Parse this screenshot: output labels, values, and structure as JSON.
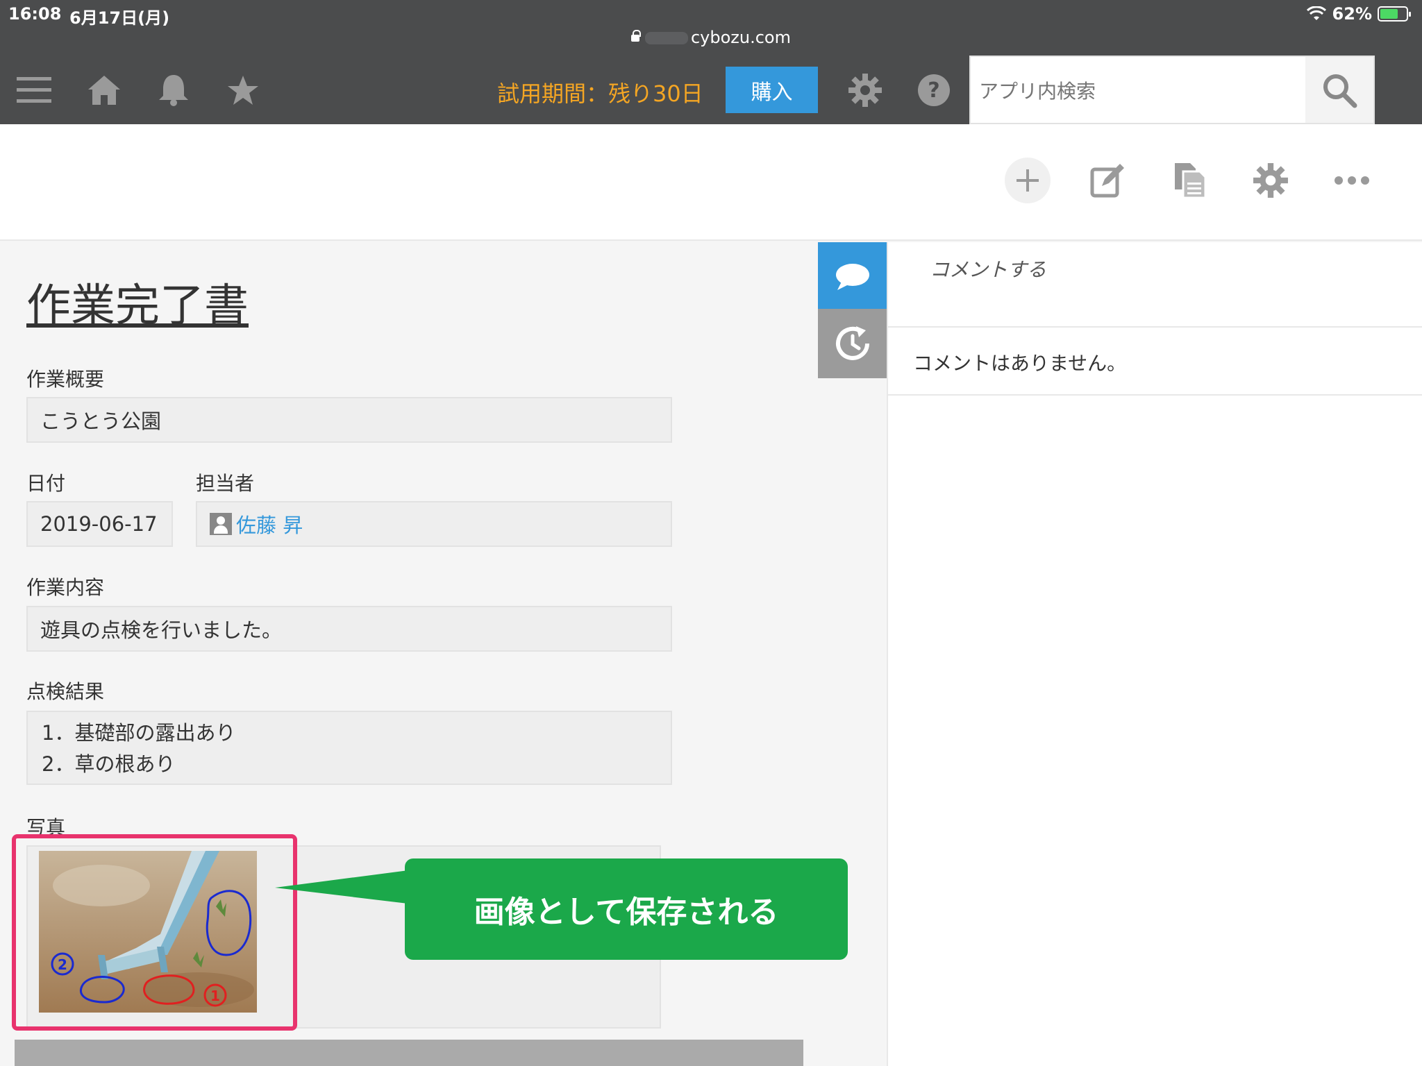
{
  "status_bar": {
    "time": "16:08",
    "date": "6月17日(月)",
    "url": "cybozu.com",
    "battery": "62%",
    "battery_level": 0.62
  },
  "header": {
    "trial_text": "試用期間：残り30日",
    "buy_label": "購入",
    "search_placeholder": "アプリ内検索",
    "trial_color": "#f5a623",
    "buy_color": "#3498db"
  },
  "record": {
    "title": "作業完了書",
    "fields": {
      "summary_label": "作業概要",
      "summary_value": "こうとう公園",
      "date_label": "日付",
      "date_value": "2019-06-17",
      "assignee_label": "担当者",
      "assignee_value": "佐藤 昇",
      "content_label": "作業内容",
      "content_value": "遊具の点検を行いました。",
      "result_label": "点検結果",
      "result_lines": [
        "1．基礎部の露出あり",
        "2．草の根あり"
      ],
      "photo_label": "写真"
    }
  },
  "callout": {
    "text": "画像として保存される",
    "color": "#1ba84a"
  },
  "comments": {
    "input_placeholder": "コメントする",
    "empty_text": "コメントはありません。"
  },
  "icons": {
    "menu": "menu-icon",
    "home": "home-icon",
    "bell": "bell-icon",
    "star": "star-icon",
    "settings": "gear-icon",
    "help": "help-icon",
    "search": "search-icon",
    "add": "plus-icon",
    "edit": "edit-icon",
    "duplicate": "copy-icon",
    "more": "more-icon",
    "comment_tab": "speech-bubble-icon",
    "history_tab": "history-icon"
  }
}
